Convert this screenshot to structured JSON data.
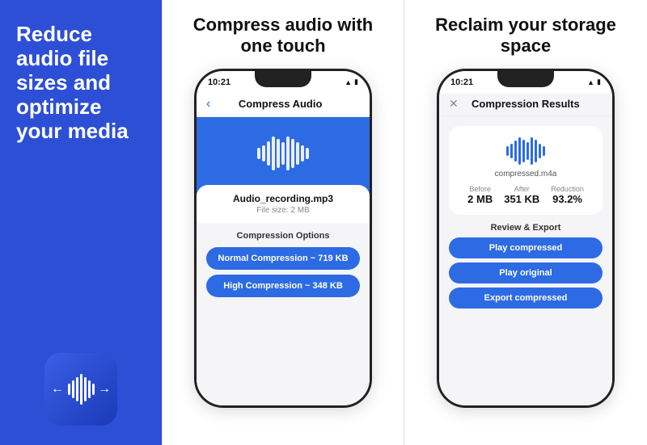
{
  "panel1": {
    "title": "Reduce audio file sizes and optimize your media",
    "accent_color": "#2d4fd6",
    "app_icon_bg": "linear-gradient(135deg, #3a5fe5, #1a3ab8)"
  },
  "panel2": {
    "title": "Compress audio with one touch",
    "phone": {
      "time": "10:21",
      "header_title": "Compress Audio",
      "file_name": "Audio_recording.mp3",
      "file_size": "File size: 2 MB",
      "compression_options_label": "Compression Options",
      "btn_normal": "Normal Compression ~ 719 KB",
      "btn_high": "High Compression ~ 348 KB"
    }
  },
  "panel3": {
    "title": "Reclaim your storage space",
    "phone": {
      "time": "10:21",
      "header_title": "Compression Results",
      "file_name": "compressed.m4a",
      "stat_before_label": "Before",
      "stat_before_value": "2 MB",
      "stat_after_label": "After",
      "stat_after_value": "351 KB",
      "stat_reduction_label": "Reduction",
      "stat_reduction_value": "93.2%",
      "export_section_label": "Review & Export",
      "btn_play_compressed": "Play compressed",
      "btn_play_original": "Play original",
      "btn_export": "Export compressed"
    }
  }
}
